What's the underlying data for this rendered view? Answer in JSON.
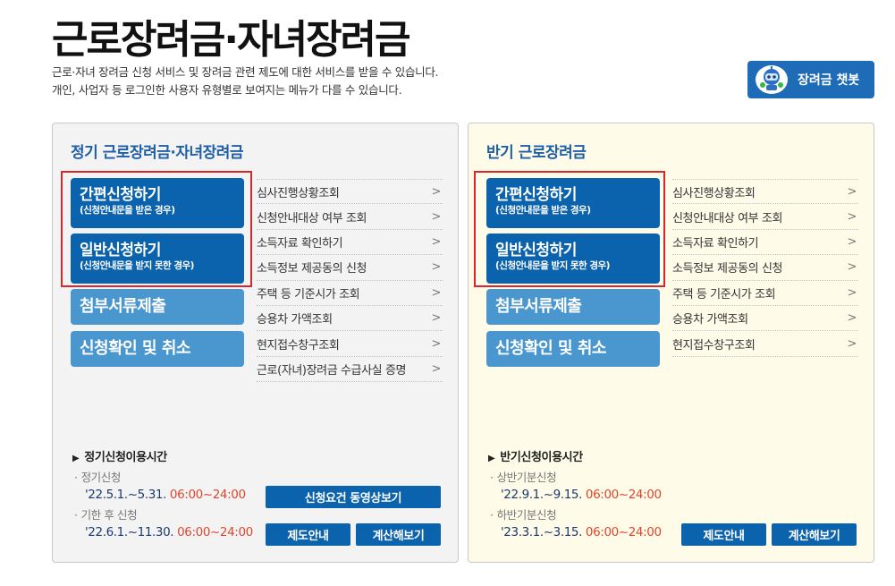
{
  "page": {
    "title": "근로장려금·자녀장려금",
    "intro_line1": "근로·자녀 장려금 신청 서비스 및 장려금 관련 제도에 대한 서비스를 받을 수 있습니다.",
    "intro_line2": "개인, 사업자 등 로그인한 사용자 유형별로 보여지는 메뉴가 다를 수 있습니다.",
    "chatbot_label": "장려금 챗봇"
  },
  "left_panel": {
    "title": "정기 근로장려금·자녀장려금",
    "simple_apply": {
      "main": "간편신청하기",
      "sub": "(신청안내문을 받은 경우)"
    },
    "general_apply": {
      "main": "일반신청하기",
      "sub": "(신청안내문을 받지 못한 경우)"
    },
    "docs_submit": "첨부서류제출",
    "confirm_cancel": "신청확인 및 취소",
    "links": [
      "심사진행상황조회",
      "신청안내대상 여부 조회",
      "소득자료 확인하기",
      "소득정보 제공동의 신청",
      "주택 등 기준시가 조회",
      "승용차 가액조회",
      "현지접수창구조회",
      "근로(자녀)장려금 수급사실 증명"
    ],
    "hours_title": "정기신청이용시간",
    "hours": [
      {
        "label": "정기신청",
        "date": "'22.5.1.~5.31.",
        "time": "06:00~24:00"
      },
      {
        "label": "기한 후 신청",
        "date": "'22.6.1.~11.30.",
        "time": "06:00~24:00"
      }
    ],
    "video_button": "신청요건 동영상보기",
    "guide_button": "제도안내",
    "calc_button": "계산해보기"
  },
  "right_panel": {
    "title": "반기 근로장려금",
    "simple_apply": {
      "main": "간편신청하기",
      "sub": "(신청안내문을 받은 경우)"
    },
    "general_apply": {
      "main": "일반신청하기",
      "sub": "(신청안내문을 받지 못한 경우)"
    },
    "docs_submit": "첨부서류제출",
    "confirm_cancel": "신청확인 및 취소",
    "links": [
      "심사진행상황조회",
      "신청안내대상 여부 조회",
      "소득자료 확인하기",
      "소득정보 제공동의 신청",
      "주택 등 기준시가 조회",
      "승용차 가액조회",
      "현지접수창구조회"
    ],
    "hours_title": "반기신청이용시간",
    "hours": [
      {
        "label": "상반기분신청",
        "date": "'22.9.1.~9.15.",
        "time": "06:00~24:00"
      },
      {
        "label": "하반기분신청",
        "date": "'23.3.1.~3.15.",
        "time": "06:00~24:00"
      }
    ],
    "guide_button": "제도안내",
    "calc_button": "계산해보기"
  },
  "icons": {
    "chatbot": "robot-icon",
    "link_arrow": "chevron-right-icon",
    "section_marker": "triangle-right-icon"
  },
  "colors": {
    "primary_blue": "#0c63ad",
    "secondary_blue": "#4a96cf",
    "title_blue": "#1f5fa6",
    "highlight_red": "#d9262b",
    "time_orange": "#e0452b",
    "left_panel_bg": "#f3f3f3",
    "right_panel_bg": "#fefbe9"
  }
}
